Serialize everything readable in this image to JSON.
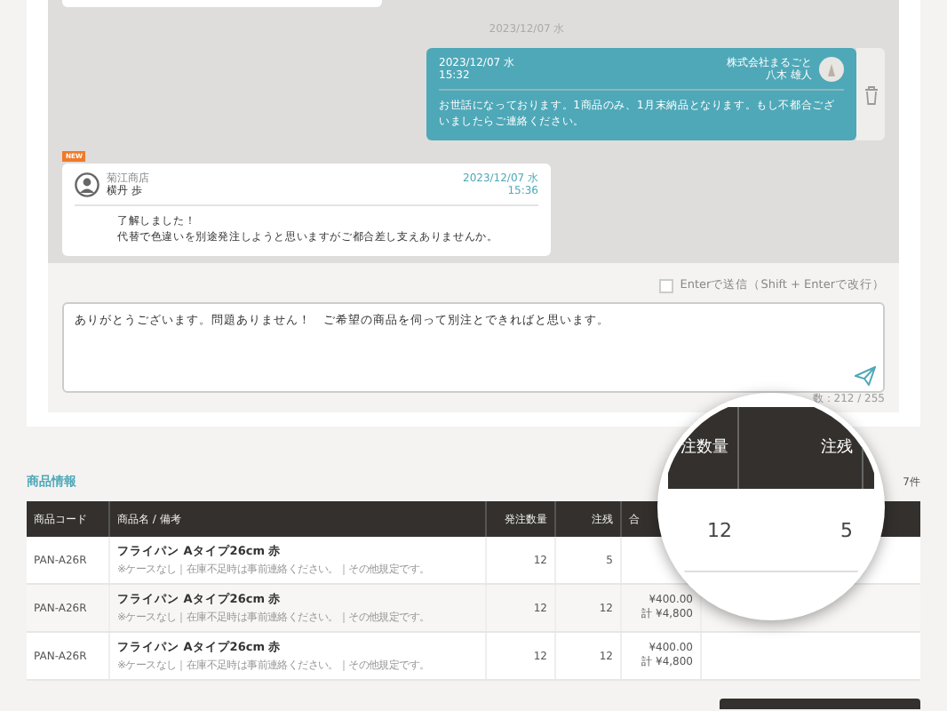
{
  "chat": {
    "date_divider": "2023/12/07 水",
    "messages": [
      {
        "kind": "outgoing",
        "date": "2023/12/07 水",
        "time": "15:32",
        "company": "株式会社まるごと",
        "sender": "八木 雄人",
        "lines": [
          "お世話になっております。1商品のみ、1月末納品となります。もし不都合ございましたらご連絡ください。"
        ],
        "is_new": false
      },
      {
        "kind": "incoming",
        "date": "2023/12/07 水",
        "time": "15:36",
        "company": "菊江商店",
        "sender": "横丹 歩",
        "lines": [
          "了解しました！",
          "代替で色違いを別途発注しようと思いますがご都合差し支えありませんか。"
        ],
        "is_new": true,
        "badge": "NEW"
      }
    ]
  },
  "composer": {
    "enter_to_send": {
      "label": "Enterで送信（Shift + Enterで改行）",
      "checked": false
    },
    "value": "ありがとうございます。問題ありません！　ご希望の商品を伺って別注とできればと思います。",
    "counter": "数：212 / 255"
  },
  "products": {
    "title": "商品情報",
    "count": "7件",
    "columns": [
      "商品コード",
      "商品名 / 備考",
      "発注数量",
      "注残",
      "合"
    ],
    "rows": [
      {
        "code": "PAN-A26R",
        "name": "フライパン Aタイプ26cm 赤",
        "note": "※ケースなし｜在庫不足時は事前連絡ください。｜その他規定です。",
        "qty": "12",
        "remaining": "5"
      },
      {
        "code": "PAN-A26R",
        "name": "フライパン Aタイプ26cm 赤",
        "note": "※ケースなし｜在庫不足時は事前連絡ください。｜その他規定です。",
        "qty": "12",
        "remaining": "12",
        "price": "¥400.00",
        "total": "計 ¥4,800"
      },
      {
        "code": "PAN-A26R",
        "name": "フライパン Aタイプ26cm 赤",
        "note": "※ケースなし｜在庫不足時は事前連絡ください。｜その他規定です。",
        "qty": "12",
        "remaining": "12",
        "price": "¥400.00",
        "total": "計 ¥4,800"
      }
    ]
  },
  "magnifier": {
    "columns": [
      "注数量",
      "注残"
    ],
    "values": [
      "12",
      "5"
    ]
  }
}
